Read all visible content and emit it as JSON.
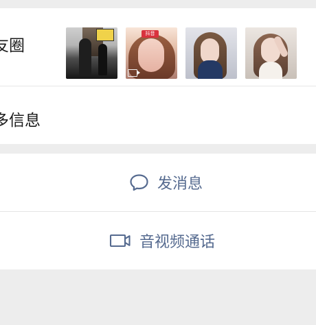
{
  "contact_profile": {
    "moments_label": "友圈",
    "more_info_label": "多信息",
    "thumbnail_badge": "抖音"
  },
  "actions": {
    "send_message": "发消息",
    "video_call": "音视频通话"
  },
  "icons": {
    "message": "chat-bubble-icon",
    "video": "video-camera-icon"
  },
  "colors": {
    "background": "#ededed",
    "card": "#ffffff",
    "text": "#191919",
    "accent": "#556a8f"
  }
}
